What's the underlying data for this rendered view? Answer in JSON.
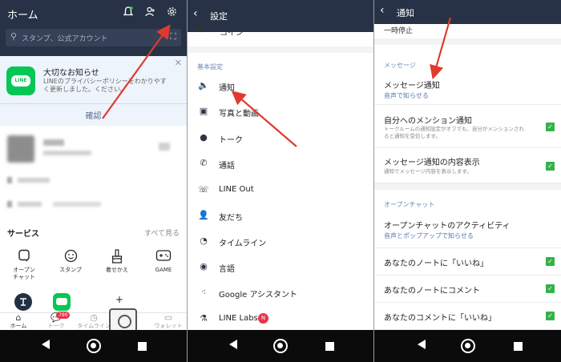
{
  "colors": {
    "header": "#273246",
    "line_green": "#06c755",
    "arrow_red": "#e03a2e",
    "check_green": "#33b24b",
    "badge_red": "#e6354b",
    "link_blue": "#5878b0"
  },
  "panel1": {
    "title": "ホーム",
    "search_placeholder": "スタンプ、公式アカウント",
    "notice": {
      "logo_text": "LINE",
      "title": "大切なお知らせ",
      "body": "LINEのプライバシーポリシーをわかりやすく更新しました。ください。",
      "confirm": "確認"
    },
    "services": {
      "title": "サービス",
      "see_all": "すべて見る",
      "items": [
        {
          "label": "オープン\nチャット",
          "icon": "open-chat-icon"
        },
        {
          "label": "スタンプ",
          "icon": "sticker-icon"
        },
        {
          "label": "着せかえ",
          "icon": "theme-brush-icon"
        },
        {
          "label": "GAME",
          "icon": "game-controller-icon"
        }
      ],
      "plus": "+"
    },
    "tabs": [
      {
        "label": "ホーム",
        "icon": "home-icon"
      },
      {
        "label": "トーク",
        "icon": "chat-icon"
      },
      {
        "label": "タイムライン",
        "icon": "timeline-icon"
      },
      {
        "label": "ス",
        "icon": "news-icon"
      },
      {
        "label": "ウォレット",
        "icon": "wallet-icon"
      }
    ],
    "talk_badge": "790"
  },
  "panel2": {
    "title": "設定",
    "partial_item": "コイン",
    "section": "基本設定",
    "items": [
      {
        "label": "通知",
        "icon": "speaker-icon"
      },
      {
        "label": "写真と動画",
        "icon": "photo-icon"
      },
      {
        "label": "トーク",
        "icon": "talk-icon"
      },
      {
        "label": "通話",
        "icon": "phone-icon"
      },
      {
        "label": "LINE Out",
        "icon": "line-out-icon"
      },
      {
        "label": "友だち",
        "icon": "friends-icon"
      },
      {
        "label": "タイムライン",
        "icon": "clock-icon"
      },
      {
        "label": "言語",
        "icon": "language-icon"
      },
      {
        "label": "Google アシスタント",
        "icon": "assistant-icon"
      },
      {
        "label": "LINE Labs",
        "icon": "flask-icon"
      }
    ],
    "labs_badge": "N"
  },
  "panel3": {
    "title": "通知",
    "partial_item": "一時停止",
    "section_message": "メッセージ",
    "message_notif": {
      "title": "メッセージ通知",
      "sub": "音声で知らせる"
    },
    "mention": {
      "title": "自分へのメンション通知",
      "desc": "トークルームの通知設定がオフでも、自分がメンションされると通知を受信します。"
    },
    "content_display": {
      "title": "メッセージ通知の内容表示",
      "desc": "通知でメッセージ内容を表示します。"
    },
    "section_openchat": "オープンチャット",
    "openchat_activity": {
      "title": "オープンチャットのアクティビティ",
      "sub": "音声とポップアップで知らせる"
    },
    "note_like": "あなたのノートに「いいね」",
    "note_comment": "あなたのノートにコメント",
    "comment_like": "あなたのコメントに「いいね」"
  }
}
